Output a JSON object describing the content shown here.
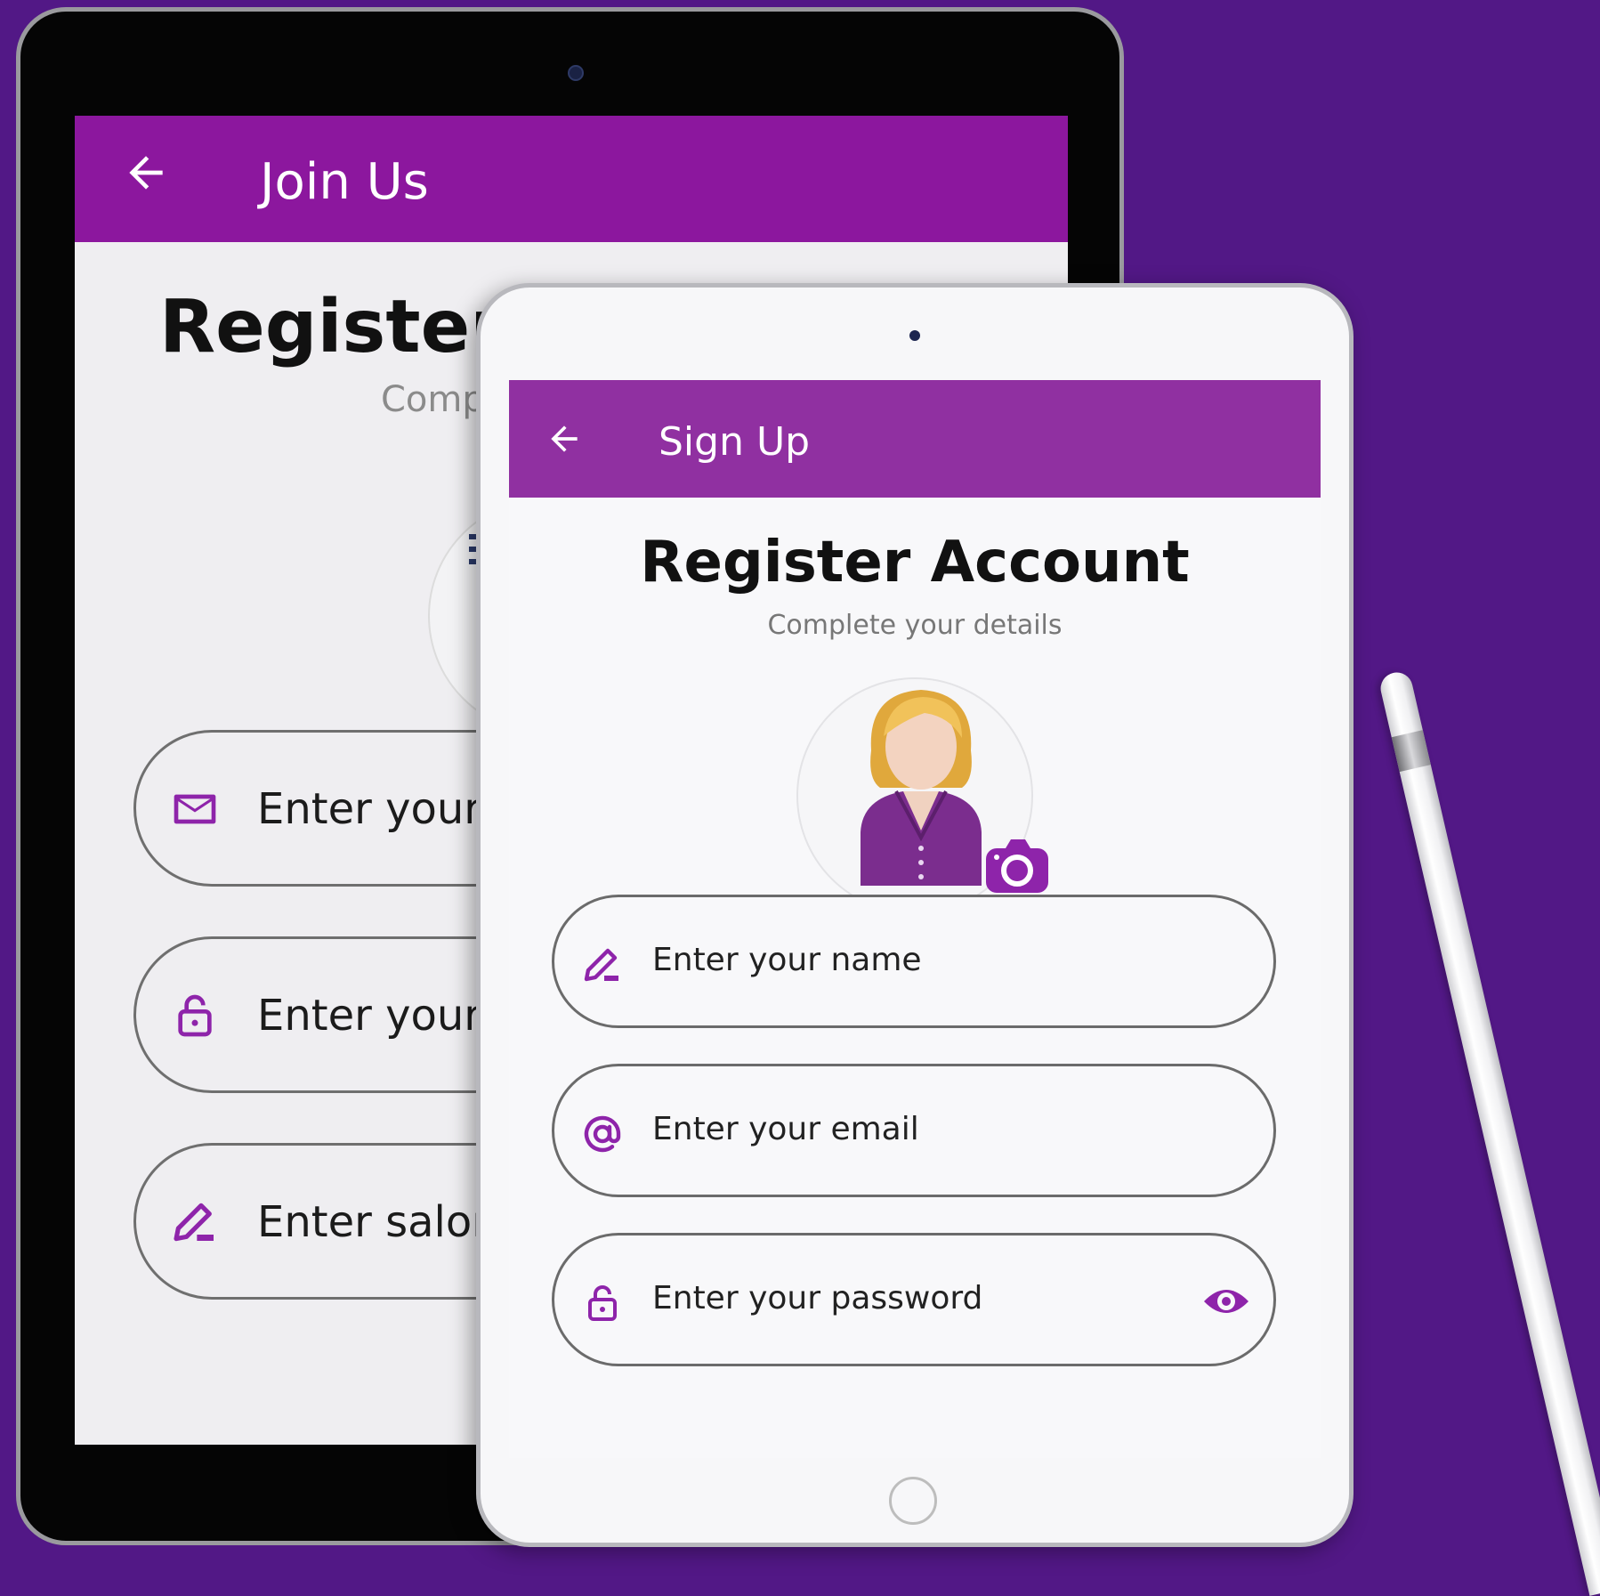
{
  "back_screen": {
    "title": "Join Us",
    "heading": "Register S",
    "subtitle": "Comp",
    "fields": [
      {
        "icon": "mail-icon",
        "placeholder": "Enter your e"
      },
      {
        "icon": "lock-icon",
        "placeholder": "Enter your p"
      },
      {
        "icon": "edit-icon",
        "placeholder": "Enter salon"
      }
    ]
  },
  "front_screen": {
    "title": "Sign Up",
    "heading": "Register Account",
    "subtitle": "Complete your details",
    "fields": {
      "name": {
        "icon": "edit-icon",
        "placeholder": "Enter your name"
      },
      "email": {
        "icon": "at-icon",
        "placeholder": "Enter your email"
      },
      "password": {
        "icon": "lock-icon",
        "placeholder": "Enter your password",
        "toggle_icon": "eye-icon"
      }
    }
  },
  "colors": {
    "background": "#521886",
    "appbar_back": "#8c179e",
    "appbar_front": "#9030a1",
    "accent": "#8e24aa"
  }
}
